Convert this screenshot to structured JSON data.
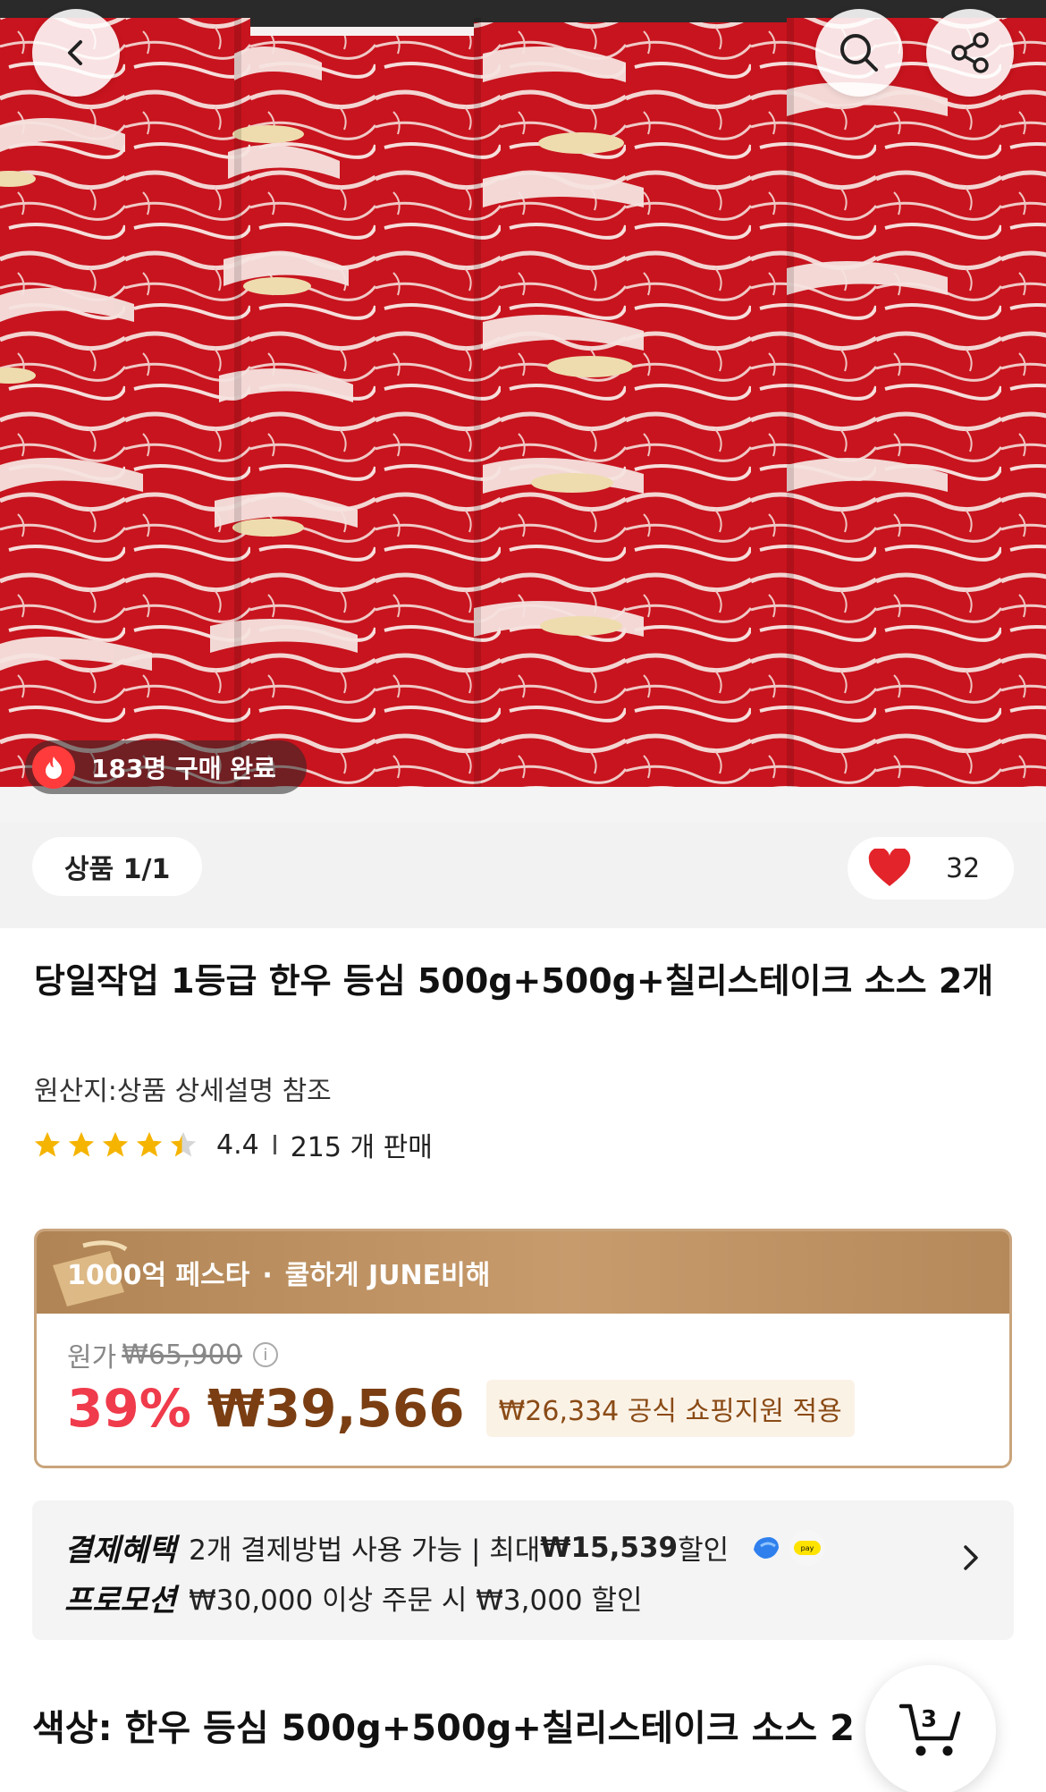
{
  "header": {
    "purchase_badge": "183명 구매 완료"
  },
  "product": {
    "pager": "상품 1/1",
    "likes": "32",
    "title": "당일작업 1등급 한우 등심 500g+500g+칠리스테이크 소스 2개",
    "origin": "원산지:상품 상세설명 참조",
    "rating": 4.4,
    "rating_text": "4.4",
    "sold_text": "215 개 판매"
  },
  "price_card": {
    "banner_left": "1000억 페스타",
    "banner_dot": "·",
    "banner_right": "쿨하게 JUNE비해",
    "original_label": "원가",
    "original_price": "₩65,900",
    "discount_pct": "39%",
    "sale_price": "₩39,566",
    "support_text": "₩26,334 공식 쇼핑지원 적용"
  },
  "benefits": {
    "payment_label": "결제혜택",
    "payment_text_a": "2개 결제방법 사용 가능 | 최대 ",
    "payment_amount": "₩15,539",
    "payment_text_b": " 할인",
    "promo_label": "프로모션",
    "promo_text": "₩30,000 이상 주문 시 ₩3,000 할인"
  },
  "option": {
    "line": "색상: 한우 등심 500g+500g+칠리스테이크 소스 2"
  },
  "cart": {
    "count": "3"
  },
  "colors": {
    "discount": "#ef3b4b",
    "price": "#7a3e12",
    "heart": "#e3242b",
    "star": "#f5b400",
    "banner": "#c09060"
  },
  "icons": [
    "back-icon",
    "search-icon",
    "share-icon",
    "fire-icon",
    "heart-icon",
    "star-icon",
    "info-icon",
    "chevron-right-icon",
    "cart-icon"
  ]
}
